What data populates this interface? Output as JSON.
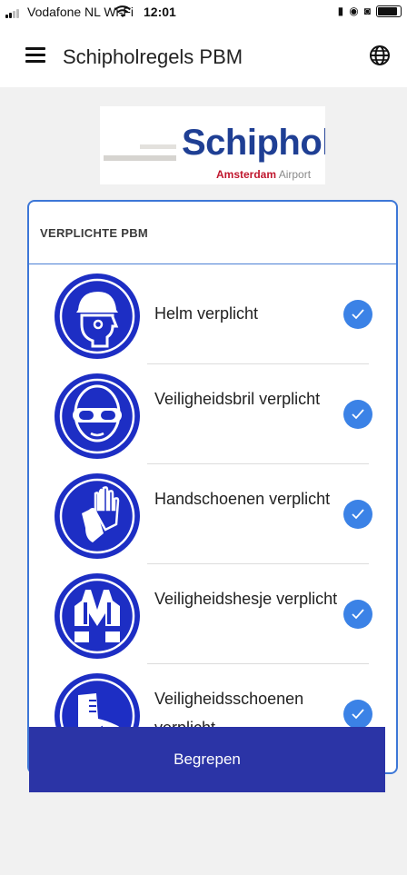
{
  "status_bar": {
    "carrier": "Vodafone NL Wi-Fi",
    "time": "12:01"
  },
  "app_bar": {
    "title": "Schipholregels PBM"
  },
  "logo": {
    "name": "Schiphol",
    "subtitle_strong": "Amsterdam",
    "subtitle_light": "Airport"
  },
  "card": {
    "title": "VERPLICHTE PBM",
    "items": [
      {
        "label": "Helm verplicht",
        "icon": "helmet-icon",
        "checked": true
      },
      {
        "label": "Veiligheidsbril verplicht",
        "icon": "safety-glasses-icon",
        "checked": true
      },
      {
        "label": "Handschoenen verplicht",
        "icon": "gloves-icon",
        "checked": true
      },
      {
        "label": "Veiligheidshesje verplicht",
        "icon": "safety-vest-icon",
        "checked": true
      },
      {
        "label": "Veiligheidsschoenen verplicht",
        "icon": "safety-shoes-icon",
        "checked": true
      }
    ]
  },
  "button": {
    "label": "Begrepen"
  },
  "colors": {
    "accent": "#3b82e6",
    "icon_blue": "#1d2ec4",
    "button": "#2b34a6",
    "card_border": "#3d77d7"
  }
}
